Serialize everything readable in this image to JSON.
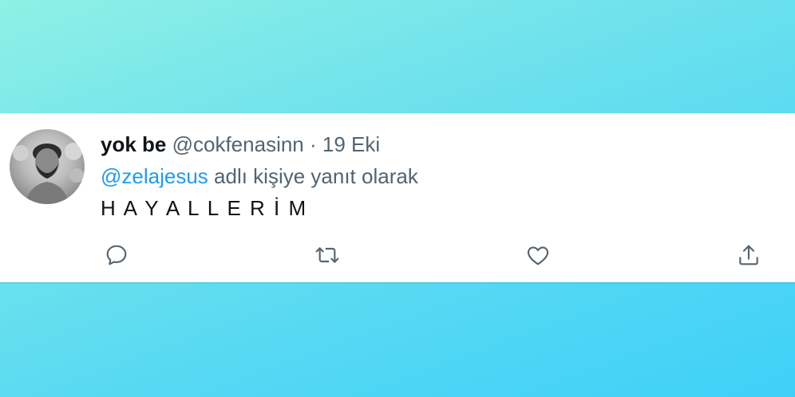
{
  "tweet": {
    "author": {
      "display_name": "yok be",
      "handle": "@cokfenasinn"
    },
    "separator": "·",
    "date": "19 Eki",
    "reply_to": {
      "mention": "@zelajesus",
      "suffix": "adlı kişiye yanıt olarak"
    },
    "text": "H A Y A L L E R İ M"
  },
  "actions": {
    "reply": "reply-icon",
    "retweet": "retweet-icon",
    "like": "heart-icon",
    "share": "share-icon"
  },
  "colors": {
    "link": "#1d9bf0",
    "muted": "#536471",
    "text": "#0f1419",
    "icon": "#536471"
  }
}
